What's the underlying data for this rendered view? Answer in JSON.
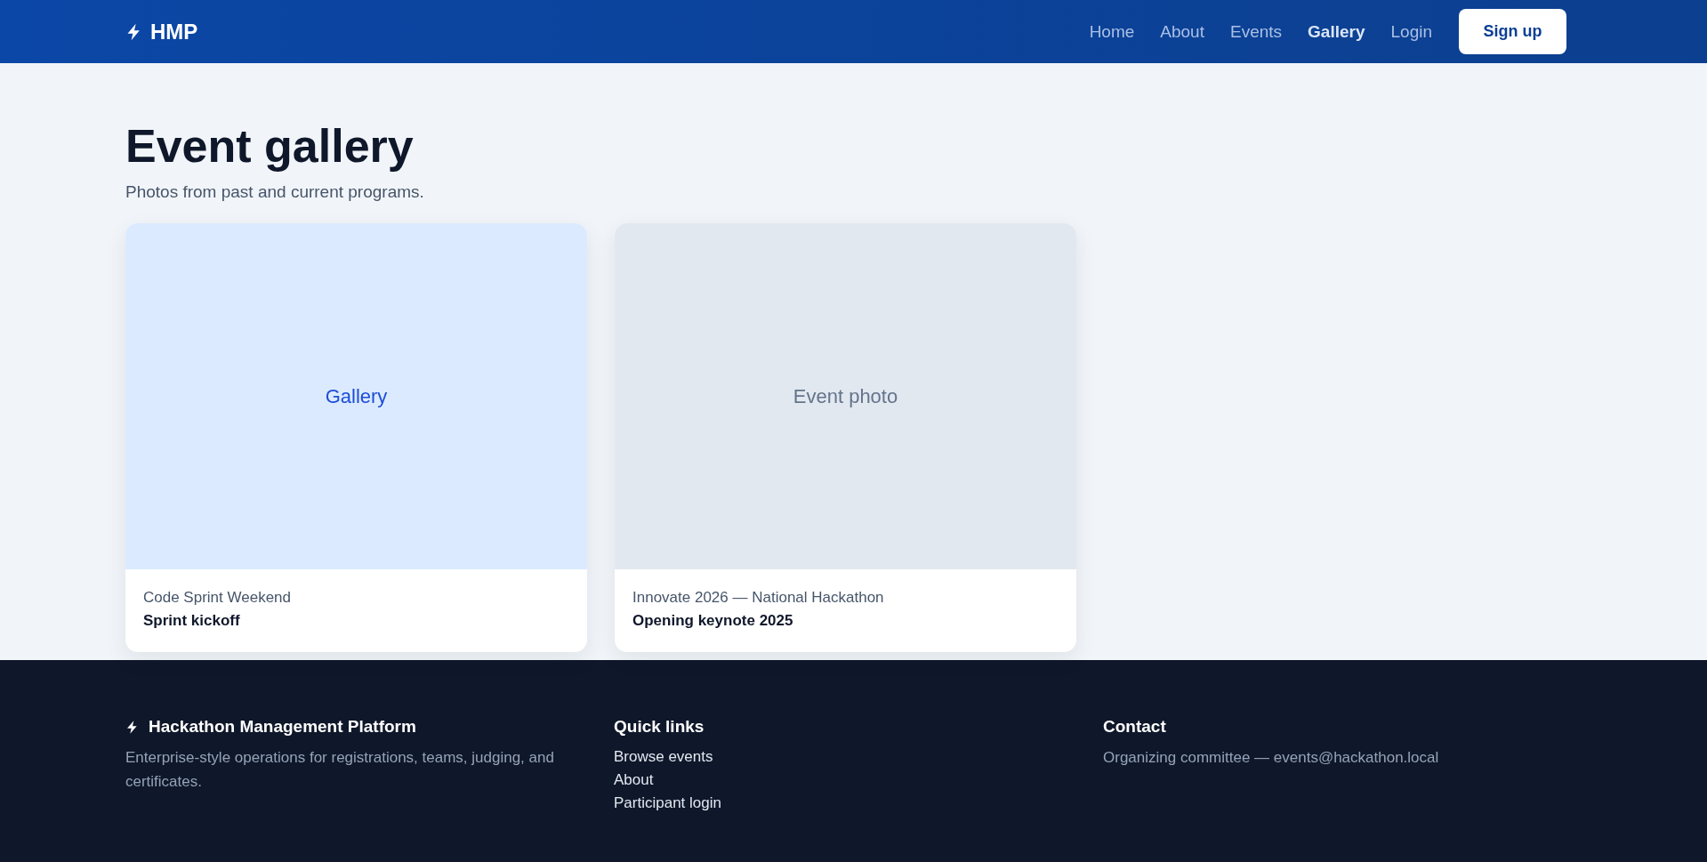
{
  "header": {
    "brand": "HMP",
    "nav": [
      {
        "label": "Home",
        "selected": false
      },
      {
        "label": "About",
        "selected": false
      },
      {
        "label": "Events",
        "selected": false
      },
      {
        "label": "Gallery",
        "selected": true
      },
      {
        "label": "Login",
        "selected": false
      }
    ],
    "cta": "Sign up"
  },
  "page": {
    "title": "Event gallery",
    "subtitle": "Photos from past and current programs."
  },
  "cards": [
    {
      "placeholder": {
        "label": "Gallery",
        "kind": "accent"
      },
      "event": "Code Sprint Weekend",
      "caption": "Sprint kickoff"
    },
    {
      "placeholder": {
        "label": "Event photo",
        "kind": "neutral"
      },
      "event": "Innovate 2026 — National Hackathon",
      "caption": "Opening keynote 2025"
    }
  ],
  "footer": {
    "brand": {
      "title": "Hackathon Management Platform",
      "text": "Enterprise-style operations for registrations, teams, judging, and certificates."
    },
    "quick_links": {
      "title": "Quick links",
      "links": [
        "Browse events",
        "About",
        "Participant login"
      ]
    },
    "contact": {
      "title": "Contact",
      "text": "Organizing committee — events@hackathon.local"
    }
  }
}
